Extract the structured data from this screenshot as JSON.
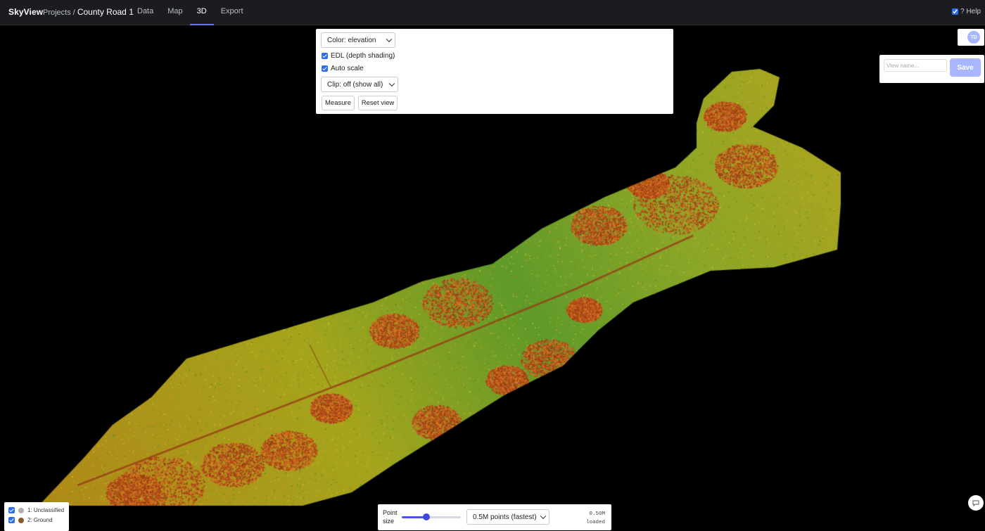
{
  "app": {
    "brand": "SkyView"
  },
  "breadcrumb": {
    "root": "Projects",
    "separator": "/",
    "current": "County Road 1"
  },
  "nav": {
    "tabs": [
      {
        "label": "Data"
      },
      {
        "label": "Map"
      },
      {
        "label": "3D",
        "active": true
      },
      {
        "label": "Export"
      }
    ]
  },
  "help": {
    "label": "? Help",
    "checked": true
  },
  "controls": {
    "color_select": "Color: elevation",
    "edl_label": "EDL (depth shading)",
    "edl_checked": true,
    "autoscale_label": "Auto scale",
    "autoscale_checked": true,
    "clip_select": "Clip: off (show all)",
    "measure_label": "Measure",
    "reset_label": "Reset view"
  },
  "user": {
    "initials": "TD",
    "avatar_color": "#a7b6ff"
  },
  "saved_view": {
    "placeholder": "View name...",
    "save_label": "Save"
  },
  "classes": [
    {
      "label": "1: Unclassified",
      "color": "#b0b0b0",
      "checked": true
    },
    {
      "label": "2: Ground",
      "color": "#8b5a2b",
      "checked": true
    }
  ],
  "point_controls": {
    "size_label": "Point size",
    "size_fraction": 0.42,
    "budget_select": "0.5M points (fastest)",
    "loaded_count": "0.50M",
    "loaded_label": "loaded"
  },
  "colors": {
    "accent": "#6b72ff",
    "checkbox": "#2f6df0",
    "slider": "#3d48e0"
  },
  "icons": {
    "chat": "chat-bubble-icon"
  }
}
